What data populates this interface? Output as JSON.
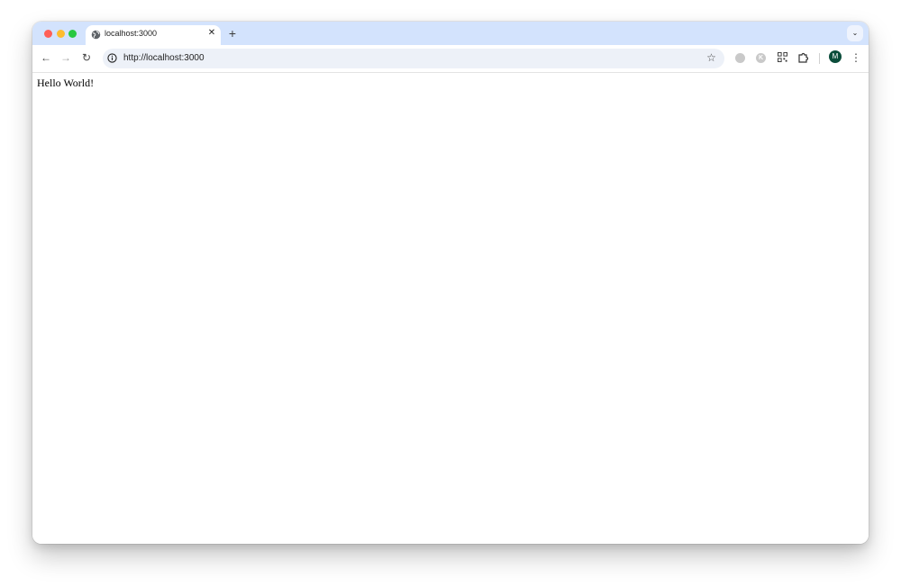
{
  "window": {
    "traffic_lights": [
      "close",
      "minimize",
      "maximize"
    ],
    "colors": {
      "tabstrip_bg": "#d3e3fd",
      "close": "#ff5f57",
      "minimize": "#febc2e",
      "maximize": "#28c840",
      "avatar_bg": "#0b4d3b"
    }
  },
  "tab": {
    "title": "localhost:3000",
    "favicon": "globe-icon",
    "close_glyph": "✕"
  },
  "toolbar": {
    "new_tab_glyph": "+",
    "tab_search_glyph": "⌄",
    "back_glyph": "←",
    "forward_glyph": "→",
    "reload_glyph": "↻",
    "url": "http://localhost:3000",
    "star_glyph": "☆",
    "extension_2_letter": "K",
    "avatar_letter": "M",
    "menu_glyph": "⋮"
  },
  "page": {
    "body_text": "Hello World!"
  }
}
